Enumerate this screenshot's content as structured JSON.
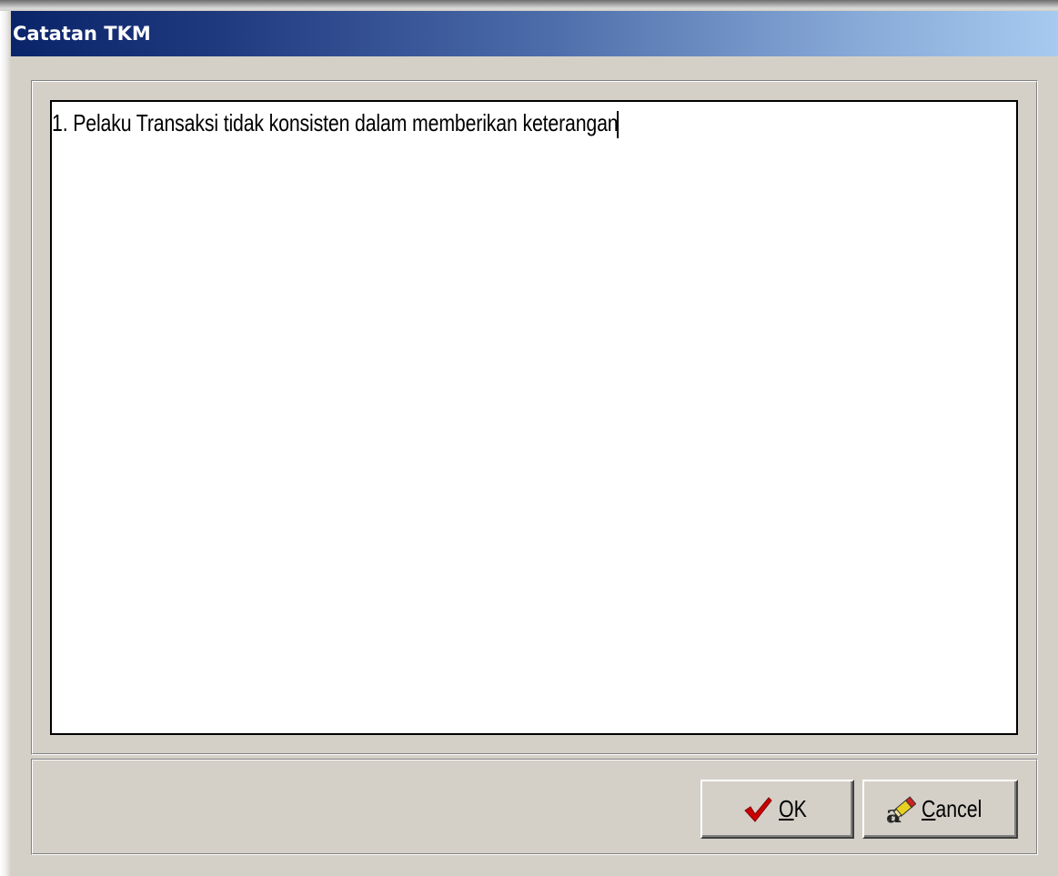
{
  "window": {
    "title": "Catatan TKM"
  },
  "memo": {
    "value": "1. Pelaku Transaksi tidak konsisten dalam memberikan keterangan"
  },
  "buttons": {
    "ok": {
      "label_underlined": "O",
      "label_rest": "K",
      "icon": "checkmark-icon"
    },
    "cancel": {
      "label_underlined": "C",
      "label_rest": "ancel",
      "icon": "eraser-icon"
    }
  },
  "colors": {
    "titlebar_start": "#0a246a",
    "titlebar_end": "#a6caf0",
    "window_bg": "#d4d0c8",
    "check_red": "#cc0000"
  }
}
